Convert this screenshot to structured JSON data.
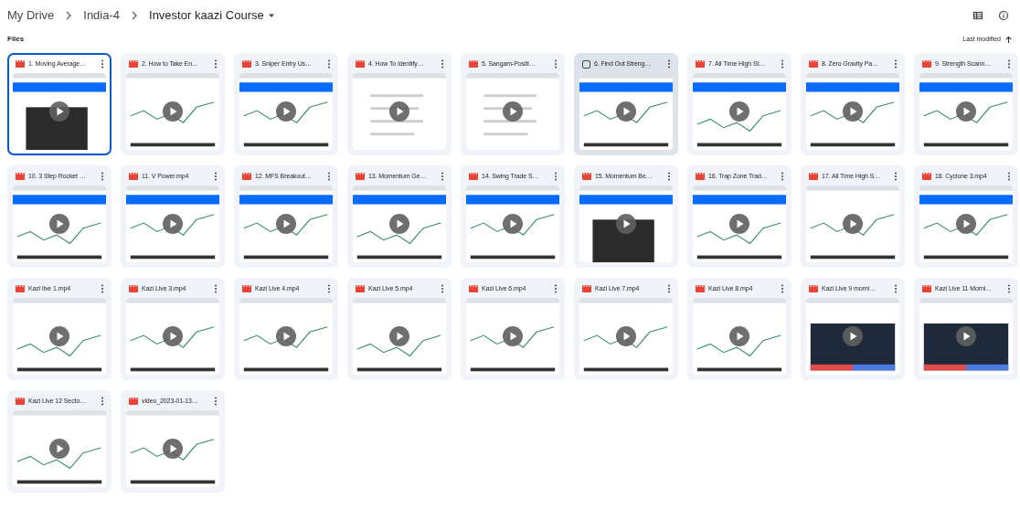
{
  "breadcrumb": [
    {
      "label": "My Drive",
      "current": false
    },
    {
      "label": "India-4",
      "current": false
    },
    {
      "label": "Investor kaazi Course",
      "current": true
    }
  ],
  "section_title": "Files",
  "sort": {
    "label": "Last modified"
  },
  "files": [
    {
      "name": "1. Moving Average…",
      "selected": true,
      "hovered": false
    },
    {
      "name": "2. How to Take En…",
      "selected": false,
      "hovered": false
    },
    {
      "name": "3. Sniper Entry Us…",
      "selected": false,
      "hovered": false
    },
    {
      "name": "4. How To Identify…",
      "selected": false,
      "hovered": false
    },
    {
      "name": "5. Sangam-Positi…",
      "selected": false,
      "hovered": false
    },
    {
      "name": "6. Find Out Streng…",
      "selected": false,
      "hovered": true
    },
    {
      "name": "7. All Time High St…",
      "selected": false,
      "hovered": false
    },
    {
      "name": "8. Zero Gravity Pa…",
      "selected": false,
      "hovered": false
    },
    {
      "name": "9. Strength Scann…",
      "selected": false,
      "hovered": false
    },
    {
      "name": "10. 3 Step Rocket …",
      "selected": false,
      "hovered": false
    },
    {
      "name": "11. V Power.mp4",
      "selected": false,
      "hovered": false
    },
    {
      "name": "12. MFS Breakout…",
      "selected": false,
      "hovered": false
    },
    {
      "name": "13. Momentum Ge…",
      "selected": false,
      "hovered": false
    },
    {
      "name": "14. Swing Trade S…",
      "selected": false,
      "hovered": false
    },
    {
      "name": "15. Momentum Be…",
      "selected": false,
      "hovered": false
    },
    {
      "name": "16. Trap Zone Trad…",
      "selected": false,
      "hovered": false
    },
    {
      "name": "17. All Time High S…",
      "selected": false,
      "hovered": false
    },
    {
      "name": "18. Cyclone 3.mp4",
      "selected": false,
      "hovered": false
    },
    {
      "name": "Kazi live 1.mp4",
      "selected": false,
      "hovered": false
    },
    {
      "name": "Kazi Live 3.mp4",
      "selected": false,
      "hovered": false
    },
    {
      "name": "Kazi Live 4.mp4",
      "selected": false,
      "hovered": false
    },
    {
      "name": "Kazi Live 5.mp4",
      "selected": false,
      "hovered": false
    },
    {
      "name": "Kazi Live 6.mp4",
      "selected": false,
      "hovered": false
    },
    {
      "name": "Kazi Live 7.mp4",
      "selected": false,
      "hovered": false
    },
    {
      "name": "Kazi Live 8.mp4",
      "selected": false,
      "hovered": false
    },
    {
      "name": "Kazi Live 9 morni…",
      "selected": false,
      "hovered": false
    },
    {
      "name": "Kazi Live 11 Morni…",
      "selected": false,
      "hovered": false
    },
    {
      "name": "Kazi Live 12 Secto…",
      "selected": false,
      "hovered": false
    },
    {
      "name": "video_2023-01-13…",
      "selected": false,
      "hovered": false
    }
  ]
}
